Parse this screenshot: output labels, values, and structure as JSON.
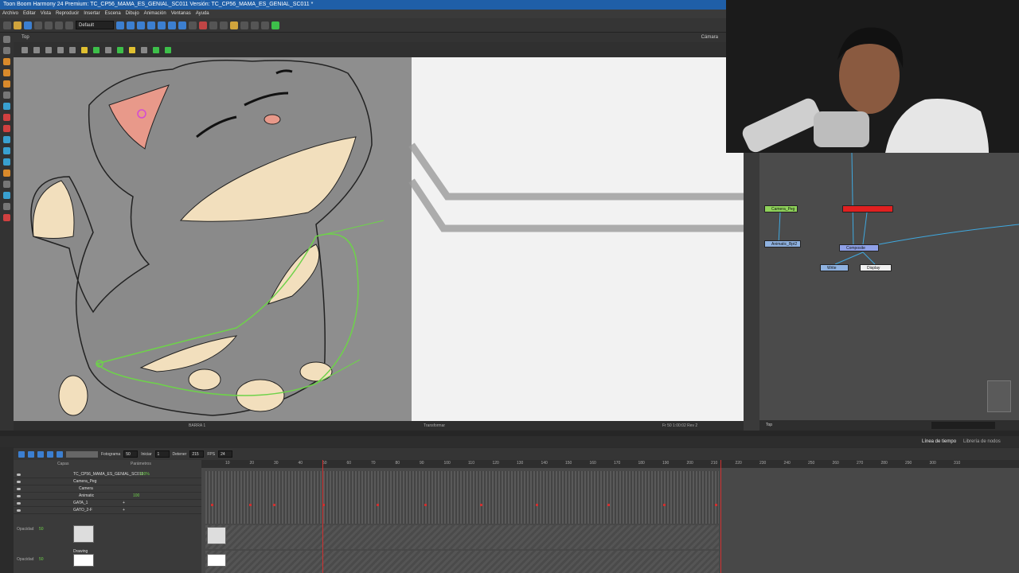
{
  "window": {
    "title": "Toon Boom Harmony 24 Premium: TC_CP56_MAMA_ES_GENIAL_SC011 Versión: TC_CP56_MAMA_ES_GENIAL_SC011 *"
  },
  "menu": [
    "Archivo",
    "Editar",
    "Vista",
    "Reproducir",
    "Insertar",
    "Escena",
    "Dibujo",
    "Animación",
    "Ventanas",
    "Ayuda"
  ],
  "toolbar": {
    "preset": "Default"
  },
  "camera_view": {
    "tab": "Top",
    "label": "Cámara",
    "status_left": "BARRA 1",
    "status_mid": "Transformar",
    "status_right": "Fr 50   1:00:02   Rev 2"
  },
  "nodes": {
    "camera_peg": "Camera_Peg",
    "red_node": "",
    "animatic": "Animatic_Bpt2",
    "composite": "Composite",
    "write": "Write",
    "display": "Display",
    "status": "Top"
  },
  "timeline": {
    "tab_timeline": "Línea de tiempo",
    "tab_library": "Librería de nodos",
    "label_fotograma": "Fotograma",
    "val_fotograma": "50",
    "label_iniciar": "Iniciar",
    "val_iniciar": "1",
    "label_detener": "Detener",
    "val_detener": "215",
    "label_fps": "FPS",
    "val_fps": "24",
    "col_capas": "Capas",
    "col_parametros": "Parámetros",
    "ruler": [
      "10",
      "20",
      "30",
      "40",
      "50",
      "60",
      "70",
      "80",
      "90",
      "100",
      "110",
      "120",
      "130",
      "140",
      "150",
      "160",
      "170",
      "180",
      "190",
      "200",
      "210",
      "220",
      "230",
      "240",
      "250",
      "260",
      "270",
      "280",
      "290",
      "300",
      "310"
    ],
    "layers": [
      {
        "name": "TC_CP56_MAMA_ES_GENIAL_SC011",
        "param": "100%"
      },
      {
        "name": "Camera_Peg",
        "param": ""
      },
      {
        "name": "Camera",
        "param": ""
      },
      {
        "name": "Animatic",
        "param": "100"
      },
      {
        "name": "GATA_1",
        "param": ""
      },
      {
        "name": "GATO_2-F",
        "param": ""
      }
    ],
    "opacity_label_1": "Opacidad",
    "opacity_val_1": "50",
    "drawing_label": "Drawing",
    "opacity_label_2": "Opacidad",
    "opacity_val_2": "50"
  }
}
